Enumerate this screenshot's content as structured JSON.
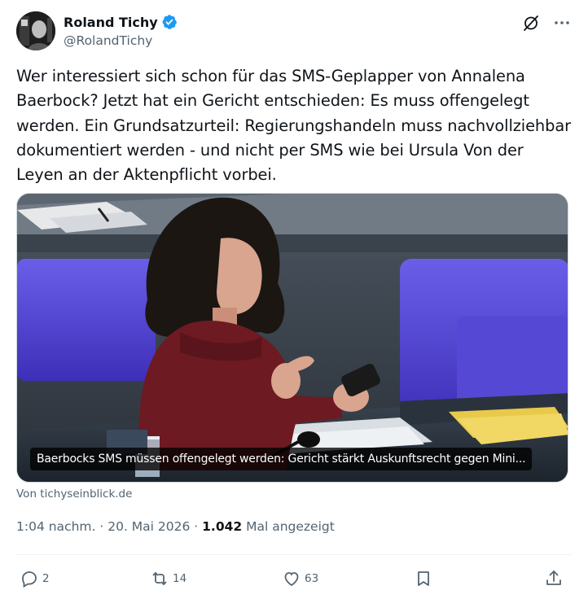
{
  "author": {
    "name": "Roland Tichy",
    "handle": "@RolandTichy"
  },
  "tweet": {
    "text": "Wer interessiert sich schon für das SMS-Geplapper von Annalena Baerbock? Jetzt hat ein Gericht entschieden: Es muss offengelegt werden. Ein Grundsatzurteil: Regierungshandeln muss nachvollziehbar dokumentiert werden - und nicht per SMS wie bei Ursula Von der Leyen an der Aktenpflicht vorbei."
  },
  "card": {
    "caption": "Baerbocks SMS müssen offengelegt werden: Gericht stärkt Auskunftsrecht gegen Mini...",
    "source": "Von tichyseinblick.de"
  },
  "meta": {
    "time": "1:04 nachm.",
    "separator": " · ",
    "date": "20. Mai 2026",
    "separator2": " · ",
    "views_count": "1.042",
    "views_label": " Mal angezeigt"
  },
  "actions": {
    "replies": "2",
    "reposts": "14",
    "likes": "63"
  },
  "colors": {
    "accent": "#1d9bf0",
    "muted": "#536471",
    "text": "#0f1419"
  },
  "icons": [
    "verified-badge-icon",
    "grok-icon",
    "more-icon",
    "reply-icon",
    "repost-icon",
    "like-icon",
    "bookmark-icon",
    "share-icon"
  ]
}
